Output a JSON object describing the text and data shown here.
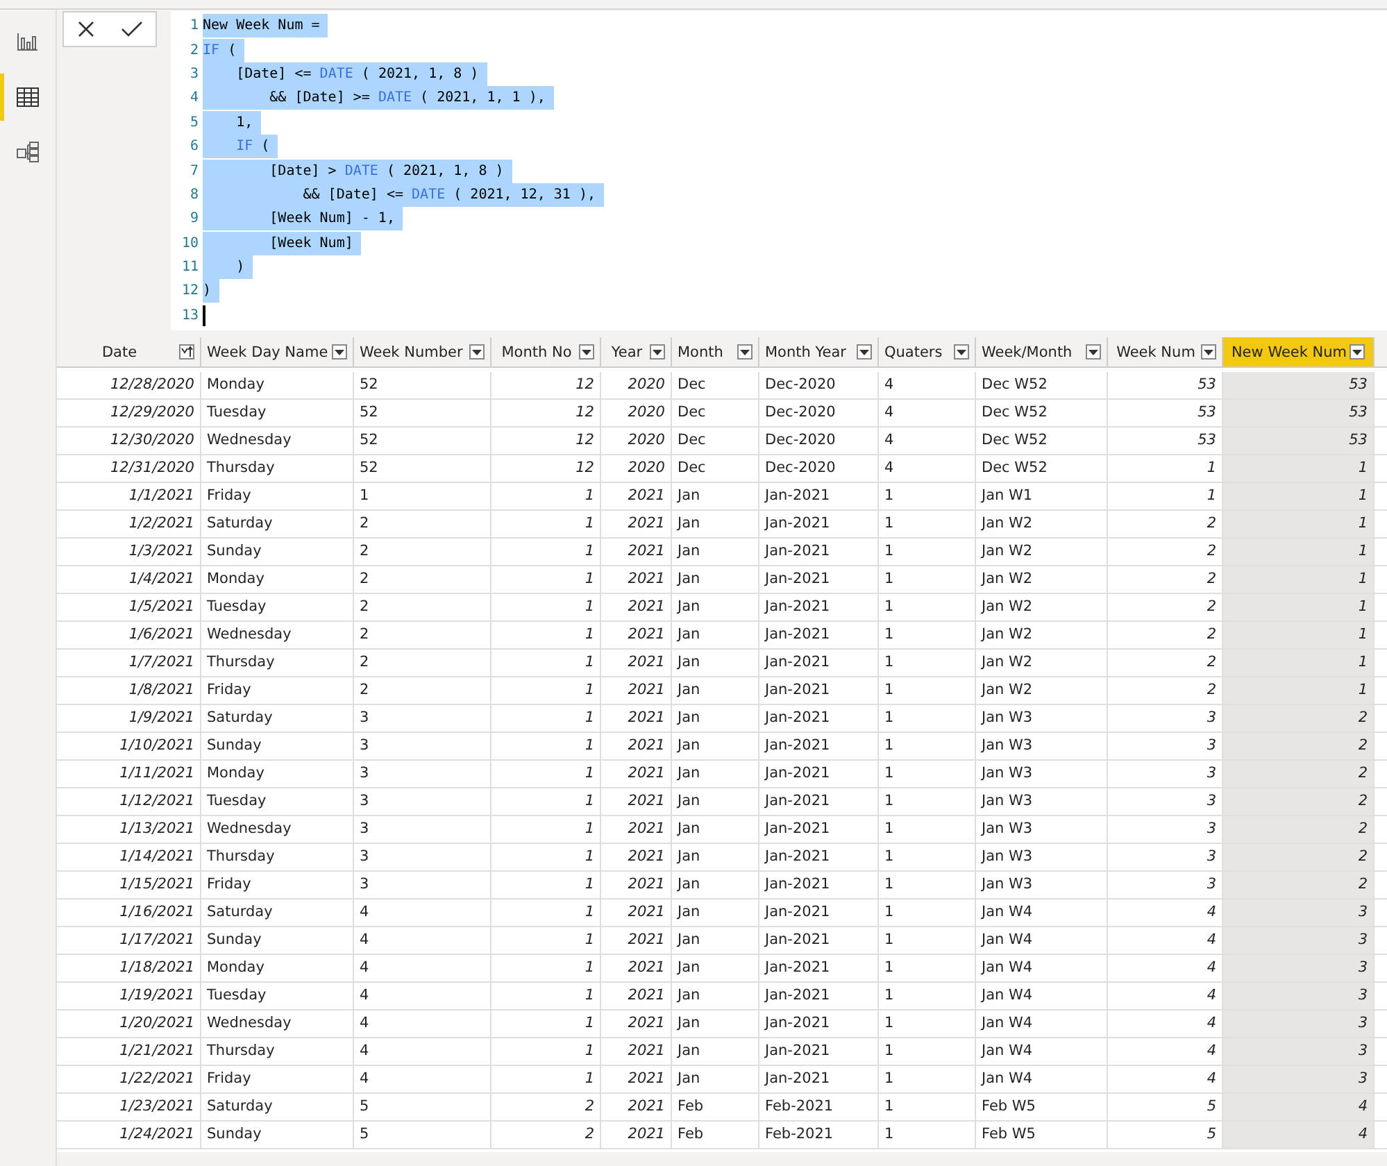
{
  "sidebar": {
    "items": [
      {
        "kind": "report",
        "selected": false
      },
      {
        "kind": "data",
        "selected": true
      },
      {
        "kind": "model",
        "selected": false
      }
    ]
  },
  "formula": {
    "lines": [
      {
        "number": "1",
        "selected": true,
        "tokens": [
          {
            "kind": "plain",
            "text": "New Week Num ="
          }
        ]
      },
      {
        "number": "2",
        "selected": true,
        "tokens": [
          {
            "kind": "keyword",
            "text": "IF"
          },
          {
            "kind": "plain",
            "text": " ("
          }
        ]
      },
      {
        "number": "3",
        "selected": true,
        "tokens": [
          {
            "kind": "plain",
            "text": "    [Date] <= "
          },
          {
            "kind": "keyword",
            "text": "DATE"
          },
          {
            "kind": "plain",
            "text": " ( 2021, 1, 8 )"
          }
        ]
      },
      {
        "number": "4",
        "selected": true,
        "tokens": [
          {
            "kind": "plain",
            "text": "        && [Date] >= "
          },
          {
            "kind": "keyword",
            "text": "DATE"
          },
          {
            "kind": "plain",
            "text": " ( 2021, 1, 1 ),"
          }
        ]
      },
      {
        "number": "5",
        "selected": true,
        "tokens": [
          {
            "kind": "plain",
            "text": "    1,"
          }
        ]
      },
      {
        "number": "6",
        "selected": true,
        "tokens": [
          {
            "kind": "keyword",
            "text": "    IF"
          },
          {
            "kind": "plain",
            "text": " ("
          }
        ]
      },
      {
        "number": "7",
        "selected": true,
        "tokens": [
          {
            "kind": "plain",
            "text": "        [Date] > "
          },
          {
            "kind": "keyword",
            "text": "DATE"
          },
          {
            "kind": "plain",
            "text": " ( 2021, 1, 8 )"
          }
        ]
      },
      {
        "number": "8",
        "selected": true,
        "tokens": [
          {
            "kind": "plain",
            "text": "            && [Date] <= "
          },
          {
            "kind": "keyword",
            "text": "DATE"
          },
          {
            "kind": "plain",
            "text": " ( 2021, 12, 31 ),"
          }
        ]
      },
      {
        "number": "9",
        "selected": true,
        "tokens": [
          {
            "kind": "plain",
            "text": "        [Week Num] - 1,"
          }
        ]
      },
      {
        "number": "10",
        "selected": true,
        "tokens": [
          {
            "kind": "plain",
            "text": "        [Week Num]"
          }
        ]
      },
      {
        "number": "11",
        "selected": true,
        "tokens": [
          {
            "kind": "plain",
            "text": "    )"
          }
        ]
      },
      {
        "number": "12",
        "selected": true,
        "tokens": [
          {
            "kind": "plain",
            "text": ")"
          }
        ]
      },
      {
        "number": "13",
        "selected": false
      }
    ]
  },
  "table": {
    "columns": [
      {
        "label": "Date",
        "kind": "number",
        "sorted": true,
        "selected": false
      },
      {
        "label": "Week Day Name",
        "kind": "text",
        "sorted": false,
        "selected": false
      },
      {
        "label": "Week Number",
        "kind": "text",
        "sorted": false,
        "selected": false
      },
      {
        "label": "Month No",
        "kind": "number",
        "sorted": false,
        "selected": false
      },
      {
        "label": "Year",
        "kind": "number",
        "sorted": false,
        "selected": false
      },
      {
        "label": "Month",
        "kind": "text",
        "sorted": false,
        "selected": false
      },
      {
        "label": "Month Year",
        "kind": "text",
        "sorted": false,
        "selected": false
      },
      {
        "label": "Quaters",
        "kind": "text",
        "sorted": false,
        "selected": false
      },
      {
        "label": "Week/Month",
        "kind": "text",
        "sorted": false,
        "selected": false
      },
      {
        "label": "Week Num",
        "kind": "number",
        "sorted": false,
        "selected": false
      },
      {
        "label": "New Week Num",
        "kind": "number",
        "sorted": false,
        "selected": true
      }
    ],
    "rows": [
      [
        "12/28/2020",
        "Monday",
        "52",
        "12",
        "2020",
        "Dec",
        "Dec-2020",
        "4",
        "Dec W52",
        "53",
        "53"
      ],
      [
        "12/29/2020",
        "Tuesday",
        "52",
        "12",
        "2020",
        "Dec",
        "Dec-2020",
        "4",
        "Dec W52",
        "53",
        "53"
      ],
      [
        "12/30/2020",
        "Wednesday",
        "52",
        "12",
        "2020",
        "Dec",
        "Dec-2020",
        "4",
        "Dec W52",
        "53",
        "53"
      ],
      [
        "12/31/2020",
        "Thursday",
        "52",
        "12",
        "2020",
        "Dec",
        "Dec-2020",
        "4",
        "Dec W52",
        "1",
        "1"
      ],
      [
        "1/1/2021",
        "Friday",
        "1",
        "1",
        "2021",
        "Jan",
        "Jan-2021",
        "1",
        "Jan W1",
        "1",
        "1"
      ],
      [
        "1/2/2021",
        "Saturday",
        "2",
        "1",
        "2021",
        "Jan",
        "Jan-2021",
        "1",
        "Jan W2",
        "2",
        "1"
      ],
      [
        "1/3/2021",
        "Sunday",
        "2",
        "1",
        "2021",
        "Jan",
        "Jan-2021",
        "1",
        "Jan W2",
        "2",
        "1"
      ],
      [
        "1/4/2021",
        "Monday",
        "2",
        "1",
        "2021",
        "Jan",
        "Jan-2021",
        "1",
        "Jan W2",
        "2",
        "1"
      ],
      [
        "1/5/2021",
        "Tuesday",
        "2",
        "1",
        "2021",
        "Jan",
        "Jan-2021",
        "1",
        "Jan W2",
        "2",
        "1"
      ],
      [
        "1/6/2021",
        "Wednesday",
        "2",
        "1",
        "2021",
        "Jan",
        "Jan-2021",
        "1",
        "Jan W2",
        "2",
        "1"
      ],
      [
        "1/7/2021",
        "Thursday",
        "2",
        "1",
        "2021",
        "Jan",
        "Jan-2021",
        "1",
        "Jan W2",
        "2",
        "1"
      ],
      [
        "1/8/2021",
        "Friday",
        "2",
        "1",
        "2021",
        "Jan",
        "Jan-2021",
        "1",
        "Jan W2",
        "2",
        "1"
      ],
      [
        "1/9/2021",
        "Saturday",
        "3",
        "1",
        "2021",
        "Jan",
        "Jan-2021",
        "1",
        "Jan W3",
        "3",
        "2"
      ],
      [
        "1/10/2021",
        "Sunday",
        "3",
        "1",
        "2021",
        "Jan",
        "Jan-2021",
        "1",
        "Jan W3",
        "3",
        "2"
      ],
      [
        "1/11/2021",
        "Monday",
        "3",
        "1",
        "2021",
        "Jan",
        "Jan-2021",
        "1",
        "Jan W3",
        "3",
        "2"
      ],
      [
        "1/12/2021",
        "Tuesday",
        "3",
        "1",
        "2021",
        "Jan",
        "Jan-2021",
        "1",
        "Jan W3",
        "3",
        "2"
      ],
      [
        "1/13/2021",
        "Wednesday",
        "3",
        "1",
        "2021",
        "Jan",
        "Jan-2021",
        "1",
        "Jan W3",
        "3",
        "2"
      ],
      [
        "1/14/2021",
        "Thursday",
        "3",
        "1",
        "2021",
        "Jan",
        "Jan-2021",
        "1",
        "Jan W3",
        "3",
        "2"
      ],
      [
        "1/15/2021",
        "Friday",
        "3",
        "1",
        "2021",
        "Jan",
        "Jan-2021",
        "1",
        "Jan W3",
        "3",
        "2"
      ],
      [
        "1/16/2021",
        "Saturday",
        "4",
        "1",
        "2021",
        "Jan",
        "Jan-2021",
        "1",
        "Jan W4",
        "4",
        "3"
      ],
      [
        "1/17/2021",
        "Sunday",
        "4",
        "1",
        "2021",
        "Jan",
        "Jan-2021",
        "1",
        "Jan W4",
        "4",
        "3"
      ],
      [
        "1/18/2021",
        "Monday",
        "4",
        "1",
        "2021",
        "Jan",
        "Jan-2021",
        "1",
        "Jan W4",
        "4",
        "3"
      ],
      [
        "1/19/2021",
        "Tuesday",
        "4",
        "1",
        "2021",
        "Jan",
        "Jan-2021",
        "1",
        "Jan W4",
        "4",
        "3"
      ],
      [
        "1/20/2021",
        "Wednesday",
        "4",
        "1",
        "2021",
        "Jan",
        "Jan-2021",
        "1",
        "Jan W4",
        "4",
        "3"
      ],
      [
        "1/21/2021",
        "Thursday",
        "4",
        "1",
        "2021",
        "Jan",
        "Jan-2021",
        "1",
        "Jan W4",
        "4",
        "3"
      ],
      [
        "1/22/2021",
        "Friday",
        "4",
        "1",
        "2021",
        "Jan",
        "Jan-2021",
        "1",
        "Jan W4",
        "4",
        "3"
      ],
      [
        "1/23/2021",
        "Saturday",
        "5",
        "2",
        "2021",
        "Feb",
        "Feb-2021",
        "1",
        "Feb W5",
        "5",
        "4"
      ],
      [
        "1/24/2021",
        "Sunday",
        "5",
        "2",
        "2021",
        "Feb",
        "Feb-2021",
        "1",
        "Feb W5",
        "5",
        "4"
      ]
    ]
  }
}
